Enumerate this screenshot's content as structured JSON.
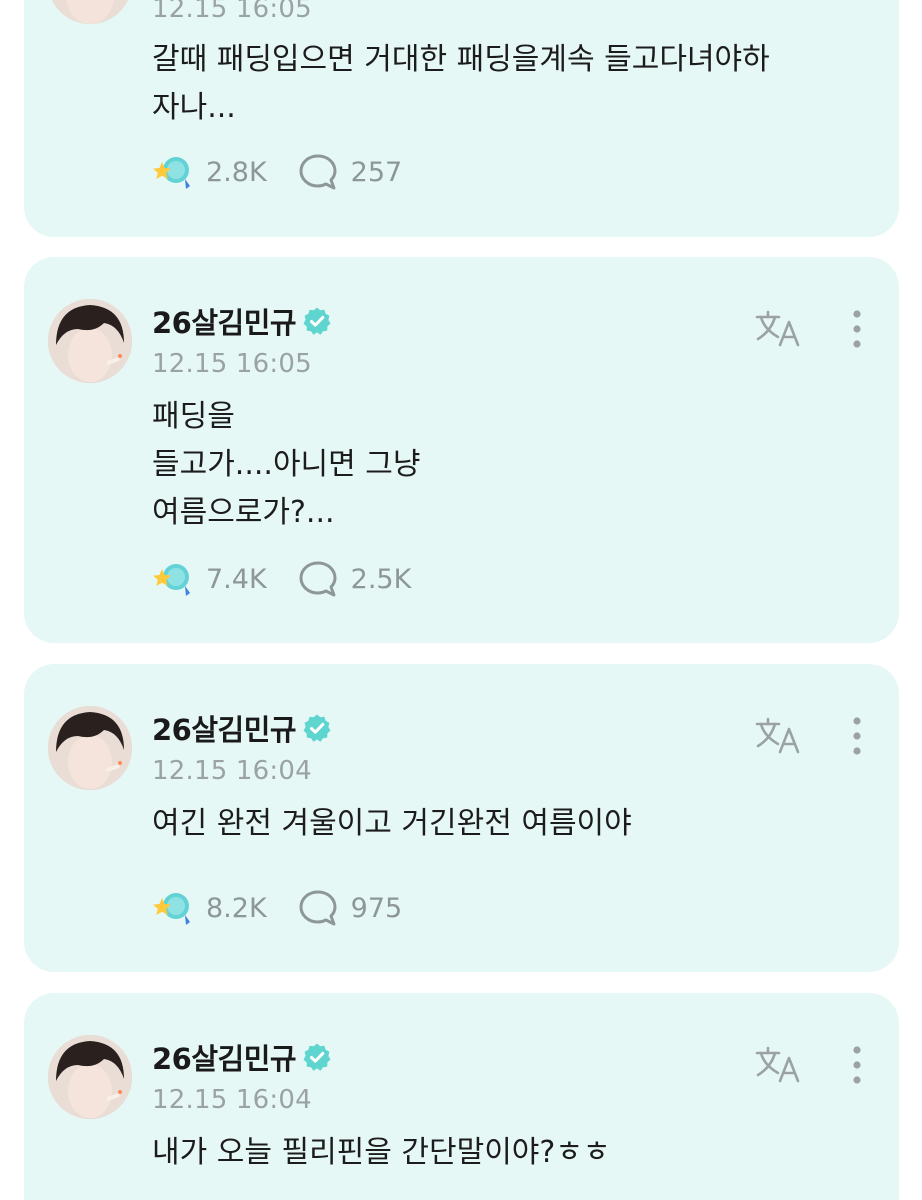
{
  "posts": [
    {
      "author": "",
      "timestamp": "12.15 16:05",
      "text": "갈때 패딩입으면 거대한 패딩을계속 들고다녀야하\n자나...",
      "likes": "2.8K",
      "comments": "257"
    },
    {
      "author": "26살김민규",
      "timestamp": "12.15 16:05",
      "text": "패딩을\n들고가....아니면 그냥\n여름으로가?...",
      "likes": "7.4K",
      "comments": "2.5K"
    },
    {
      "author": "26살김민규",
      "timestamp": "12.15 16:04",
      "text": "여긴 완전 겨울이고 거긴완전 여름이야",
      "likes": "8.2K",
      "comments": "975"
    },
    {
      "author": "26살김민규",
      "timestamp": "12.15 16:04",
      "text": "내가 오늘 필리핀을 간단말이야?ㅎㅎ",
      "likes": "",
      "comments": ""
    }
  ],
  "icons": {
    "verified": "verified-badge-icon",
    "translate": "translate-icon",
    "more": "more-vertical-icon",
    "like": "star-bulb-like-icon",
    "comment": "speech-bubble-icon"
  },
  "colors": {
    "card_background": "#e6f8f6",
    "verified_badge": "#5fd5d0",
    "muted_text": "#9aa3a2"
  }
}
